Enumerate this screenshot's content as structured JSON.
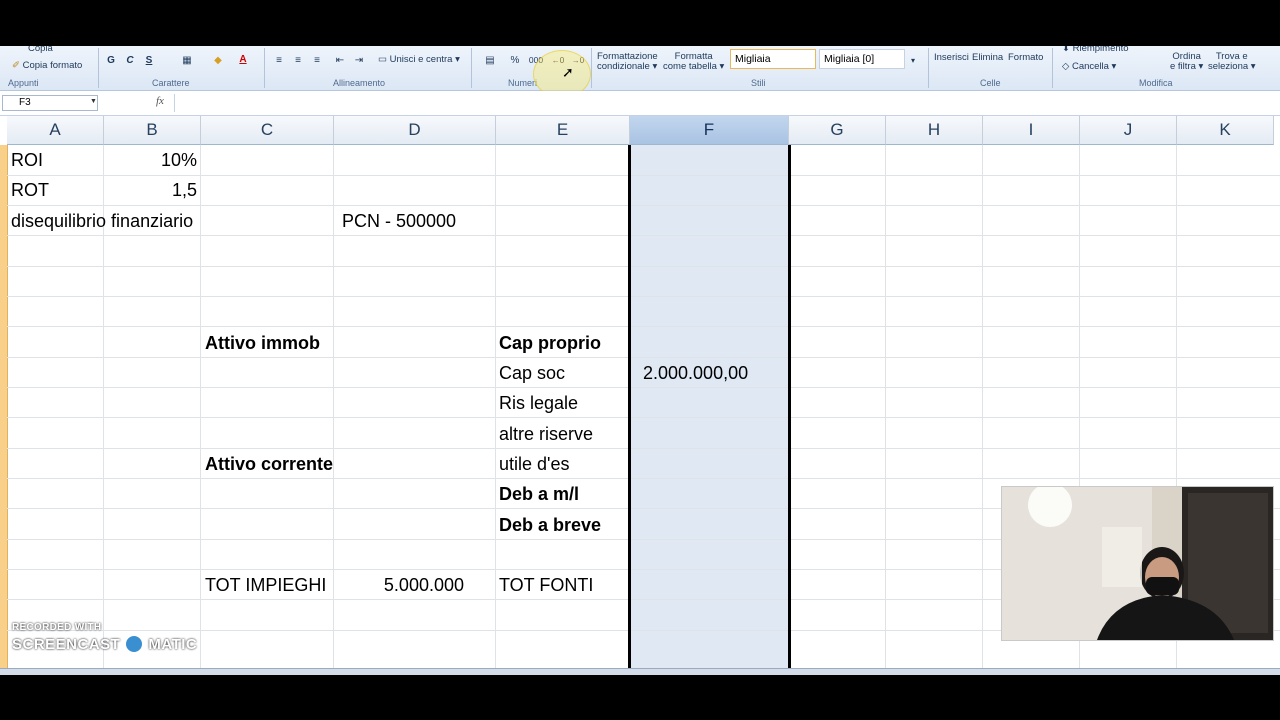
{
  "ribbon": {
    "clipboard": {
      "copy_label": "Copia",
      "format_painter_label": "Copia formato",
      "group_label": "Appunti"
    },
    "font": {
      "bold": "G",
      "italic": "C",
      "underline": "S",
      "group_label": "Carattere"
    },
    "alignment": {
      "merge_label": "Unisci e centra",
      "group_label": "Allineamento"
    },
    "number": {
      "percent": "%",
      "thousands": "000",
      "group_label": "Numeri"
    },
    "styles": {
      "conditional_label_1": "Formattazione",
      "conditional_label_2": "condizionale",
      "table_label_1": "Formatta",
      "table_label_2": "come tabella",
      "style_1": "Migliaia",
      "style_2": "Migliaia [0]",
      "group_label": "Stili"
    },
    "cells": {
      "insert_label": "Inserisci",
      "delete_label": "Elimina",
      "format_label": "Formato",
      "group_label": "Celle"
    },
    "editing": {
      "fill_label": "Riempimento",
      "clear_label": "Cancella",
      "sort_label_1": "Ordina",
      "sort_label_2": "e filtra",
      "find_label_1": "Trova e",
      "find_label_2": "seleziona",
      "group_label": "Modifica"
    }
  },
  "formula_bar": {
    "name_box": "F3",
    "fx": "fx",
    "content": ""
  },
  "columns": [
    "A",
    "B",
    "C",
    "D",
    "E",
    "F",
    "G",
    "H",
    "I",
    "J",
    "K"
  ],
  "selected_column": "F",
  "cells": {
    "A1": "ROI",
    "B1": "10%",
    "A2": "ROT",
    "B2": "1,5",
    "A3": "disequilibrio finanziario",
    "D3": "PCN - 500000",
    "C7": "Attivo immob",
    "E7": "Cap proprio",
    "E8": "Cap soc",
    "F8": "2.000.000,00",
    "E9": "Ris legale",
    "E10": "altre riserve",
    "C11": "Attivo corrente",
    "E11": "utile d'es",
    "E12": "Deb a m/l",
    "E13": "Deb a breve",
    "C15": "TOT IMPIEGHI",
    "D15": "5.000.000",
    "E15": "TOT FONTI"
  },
  "watermark": {
    "line1": "RECORDED WITH",
    "line2a": "SCREENCAST",
    "line2b": "MATIC"
  },
  "colors": {
    "selected_column": "#dfe8f3",
    "row_header": "#f8d08a",
    "ribbon": "#dce7f5"
  }
}
